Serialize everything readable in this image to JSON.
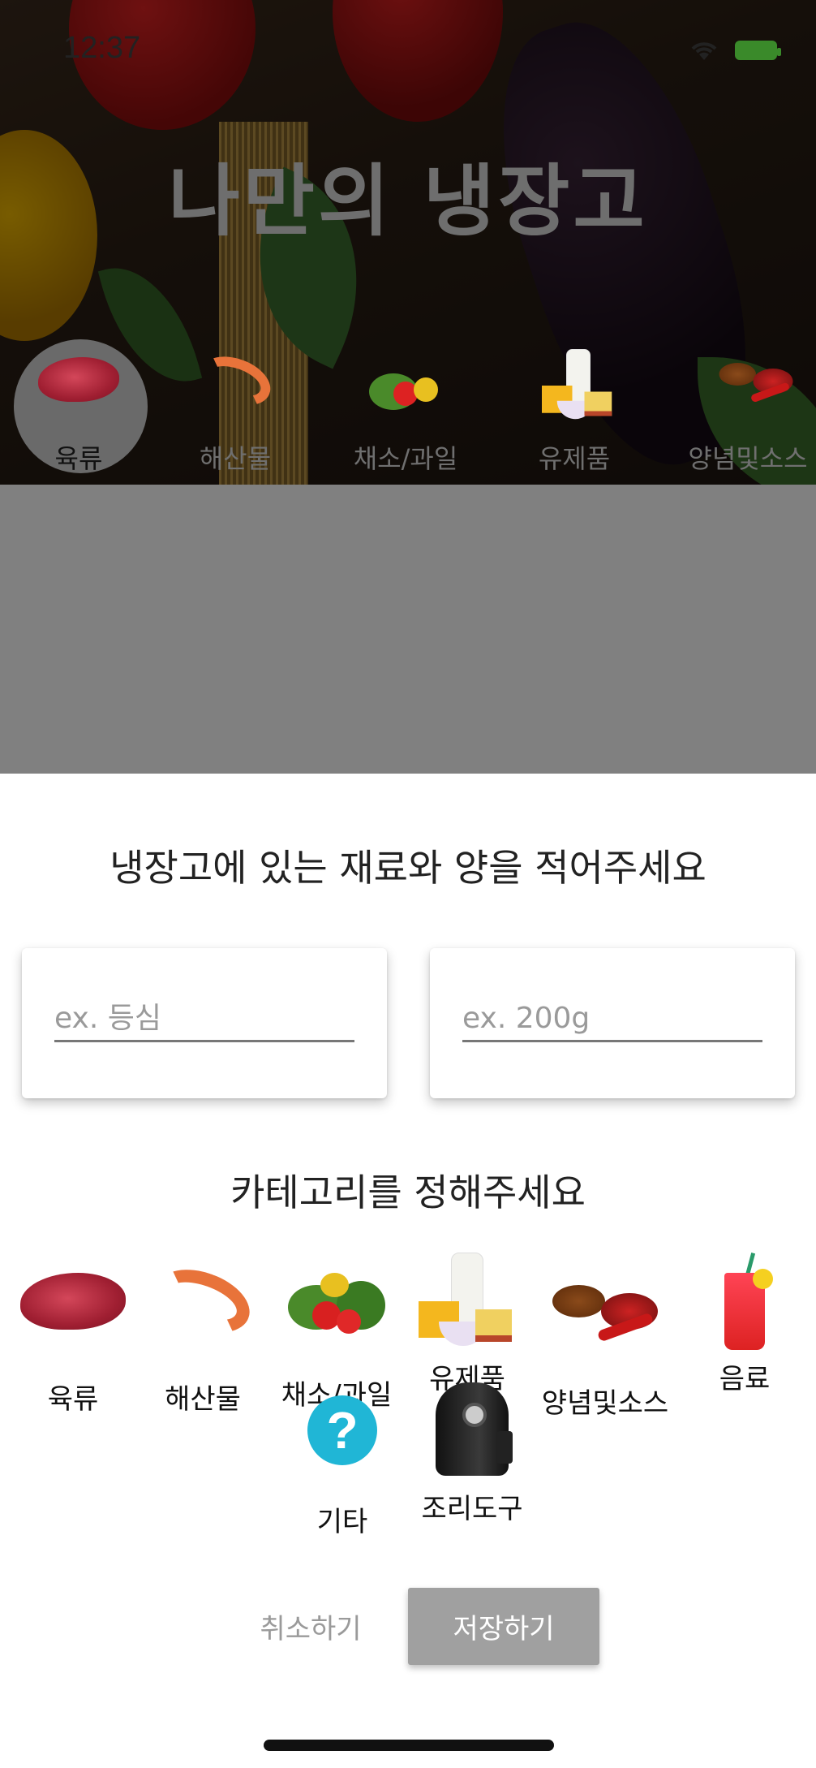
{
  "status_bar": {
    "time": "12:37"
  },
  "app": {
    "title": "나만의 냉장고"
  },
  "category_tabs": [
    {
      "label": "육류",
      "icon": "meat-icon",
      "active": true
    },
    {
      "label": "해산물",
      "icon": "shrimp-icon",
      "active": false
    },
    {
      "label": "채소/과일",
      "icon": "vegetables-icon",
      "active": false
    },
    {
      "label": "유제품",
      "icon": "dairy-icon",
      "active": false
    },
    {
      "label": "양념및소스",
      "icon": "spice-icon",
      "active": false
    }
  ],
  "dialog": {
    "title": "냉장고에 있는 재료와 양을 적어주세요",
    "ingredient_placeholder": "ex. 등심",
    "amount_placeholder": "ex. 200g",
    "category_title": "카테고리를 정해주세요",
    "categories": [
      {
        "label": "육류",
        "icon": "meat-icon"
      },
      {
        "label": "해산물",
        "icon": "shrimp-icon"
      },
      {
        "label": "채소/과일",
        "icon": "vegetables-icon"
      },
      {
        "label": "유제품",
        "icon": "dairy-icon"
      },
      {
        "label": "양념및소스",
        "icon": "spice-icon"
      },
      {
        "label": "음료",
        "icon": "drink-icon"
      },
      {
        "label": "기타",
        "icon": "question-icon"
      },
      {
        "label": "조리도구",
        "icon": "air-fryer-icon"
      }
    ],
    "cancel_label": "취소하기",
    "save_label": "저장하기"
  },
  "colors": {
    "overlay": "#808080",
    "save_button": "#a0a0a0",
    "help_icon": "#20b6d6",
    "battery": "#3a8a2a"
  }
}
